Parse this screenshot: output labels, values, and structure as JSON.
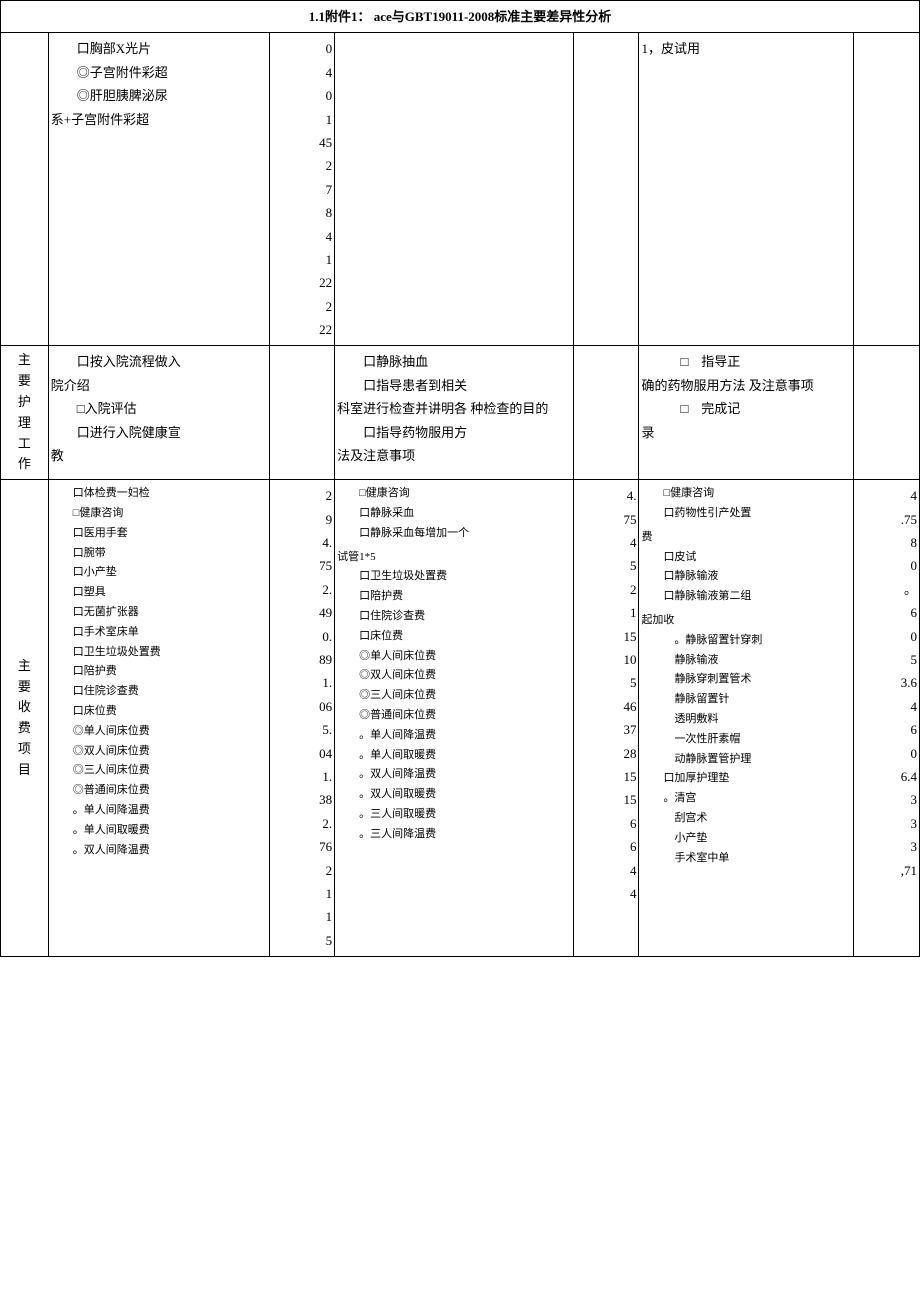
{
  "header": "1.1附件1：   ace与GBT19011-2008标准主要差异性分析",
  "row1": {
    "col2_lines": [
      "口胸部X光片",
      "◎子宫附件彩超",
      "◎肝胆胰脾泌尿",
      "系+子宫附件彩超"
    ],
    "col3_lines": [
      "0",
      "4",
      "0",
      "1",
      "45",
      "2",
      "7",
      "8",
      "4",
      "1",
      "22",
      "2",
      "22"
    ],
    "col6_lines": [
      "1，皮试用"
    ]
  },
  "row2": {
    "label": "主要护理工作",
    "col2_lines": [
      "口按入院流程做入",
      "院介绍",
      "□入院评估",
      "口进行入院健康宣",
      "教"
    ],
    "col4_lines": [
      "口静脉抽血",
      "口指导患者到相关",
      "科室进行检查并讲明各",
      "种检查的目的",
      "口指导药物服用方",
      "法及注意事项"
    ],
    "col6_lines": [
      "□　指导正",
      "确的药物服用方法",
      "及注意事项",
      "□　完成记",
      "录"
    ]
  },
  "row3": {
    "label": "主要收费项目",
    "col2_lines": [
      "口体检费一妇检",
      "□健康咨询",
      "口医用手套",
      "口腕带",
      "口小产垫",
      "口塑具",
      "口无菌扩张器",
      "口手术室床单",
      "口卫生垃圾处置费",
      "口陪护费",
      "口住院诊查费",
      "口床位费",
      "◎单人间床位费",
      "◎双人间床位费",
      "◎三人间床位费",
      "◎普通间床位费",
      "。单人间降温费",
      "。单人间取暖费",
      "。双人间降温费"
    ],
    "col3_lines": [
      "2",
      "9",
      "4.",
      "75",
      "2.",
      "49",
      "0.",
      "89",
      "1.",
      "06",
      "5.",
      "04",
      "1.",
      "38",
      "2.",
      "76",
      "2",
      "1",
      "1",
      "5"
    ],
    "col4_lines": [
      "□健康咨询",
      "口静脉采血",
      "口静脉采血每增加一个",
      "试管1*5",
      "口卫生垃圾处置费",
      "口陪护费",
      "口住院诊查费",
      "口床位费",
      "◎单人间床位费",
      "◎双人间床位费",
      "◎三人间床位费",
      "◎普通间床位费",
      "。单人间降温费",
      "。单人间取暖费",
      "。双人间降温费",
      "。双人间取暖费",
      "。三人间取暖费",
      "。三人间降温费"
    ],
    "col5_lines": [
      "4.",
      "75",
      "4",
      "5",
      "",
      "2",
      "1",
      "15",
      "",
      "10",
      "5",
      "46",
      "37",
      "28",
      "15",
      "15",
      "6",
      "6",
      "4",
      "4"
    ],
    "col6_lines": [
      "□健康咨询",
      "口药物性引产处置",
      "费",
      "口皮试",
      "口静脉输液",
      "口静脉输液第二组",
      "起加收",
      "。静脉留置针穿刺",
      "静脉输液",
      "静脉穿刺置管术",
      "静脉留置针",
      "透明敷料",
      "一次性肝素帽",
      "动静脉置管护理",
      "口加厚护理垫",
      "。清宫",
      "刮宫术",
      "小产垫",
      "手术室中单"
    ],
    "col7_lines": [
      "4",
      ".75",
      "8",
      "0",
      "。",
      "6",
      "0",
      "",
      "5",
      "3.6",
      "4",
      "6",
      "",
      "0",
      "",
      "6.4",
      "3",
      "3",
      "3",
      ",71"
    ]
  }
}
